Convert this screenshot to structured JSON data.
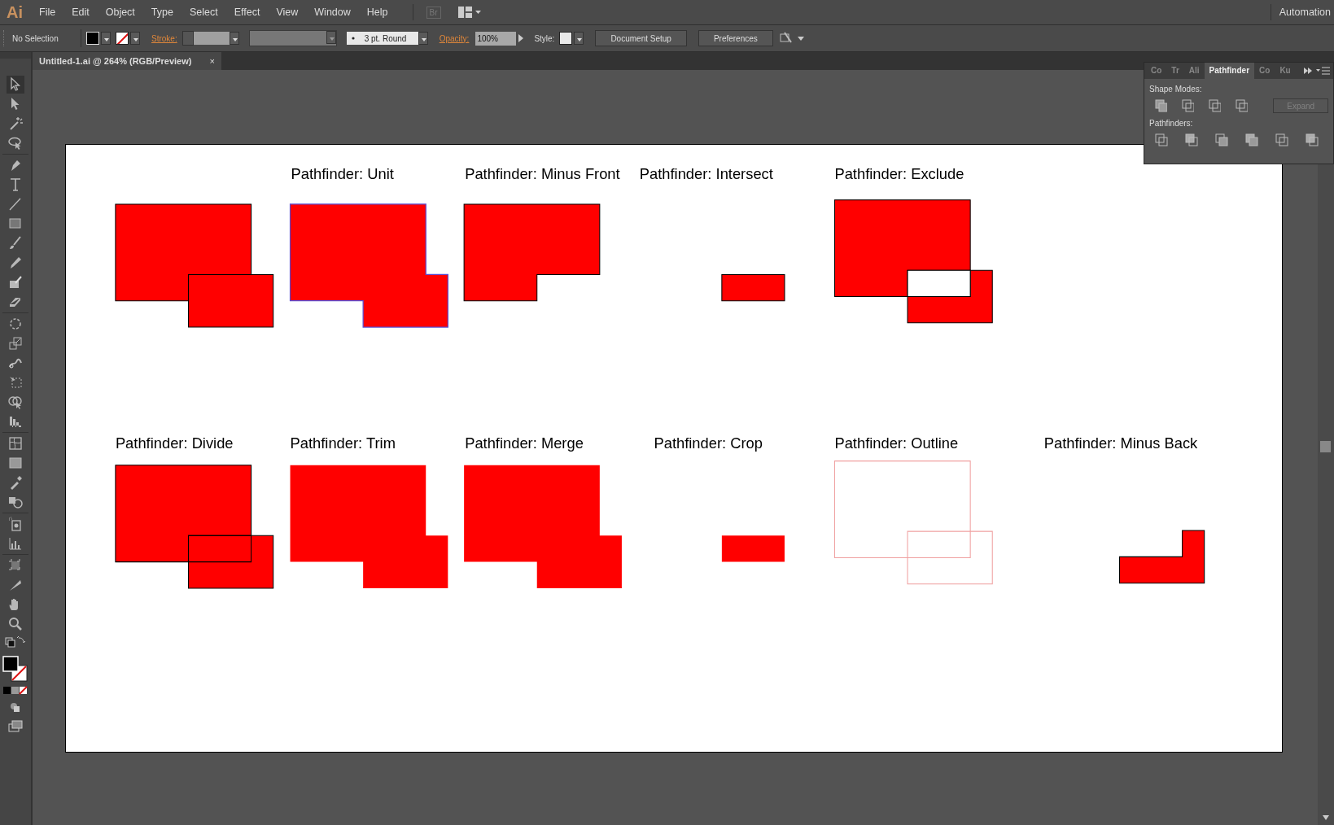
{
  "menu_bar": {
    "logo": "Ai",
    "items": [
      "File",
      "Edit",
      "Object",
      "Type",
      "Select",
      "Effect",
      "View",
      "Window",
      "Help"
    ],
    "bridge": "Br",
    "workspace": "Automation"
  },
  "control_bar": {
    "selection": "No Selection",
    "stroke_label": "Stroke:",
    "brush": "3 pt. Round",
    "opacity_label": "Opacity:",
    "opacity": "100%",
    "style_label": "Style:",
    "buttons": [
      "Document Setup",
      "Preferences"
    ]
  },
  "document_tab": {
    "title": "Untitled-1.ai @ 264% (RGB/Preview)",
    "close": "×"
  },
  "figures": [
    {
      "kind": "original"
    },
    {
      "label": "Pathfinder: Unit",
      "kind": "unite"
    },
    {
      "label": "Pathfinder: Minus Front",
      "kind": "minus_front"
    },
    {
      "label": "Pathfinder: Intersect",
      "kind": "intersect"
    },
    {
      "label": "Pathfinder: Exclude",
      "kind": "exclude"
    },
    {
      "label": "Pathfinder: Divide",
      "kind": "divide"
    },
    {
      "label": "Pathfinder: Trim",
      "kind": "trim"
    },
    {
      "label": "Pathfinder: Merge",
      "kind": "merge"
    },
    {
      "label": "Pathfinder: Crop",
      "kind": "crop"
    },
    {
      "label": "Pathfinder: Outline",
      "kind": "outline"
    },
    {
      "label": "Pathfinder: Minus Back",
      "kind": "minus_back"
    }
  ],
  "panel": {
    "tabs": [
      {
        "label": "Co",
        "selected": false
      },
      {
        "label": "Tr",
        "selected": false
      },
      {
        "label": "Ali",
        "selected": false
      },
      {
        "label": "Pathfinder",
        "selected": true
      },
      {
        "label": "Co",
        "selected": false
      },
      {
        "label": "Ku",
        "selected": false
      }
    ],
    "shape_modes_label": "Shape Modes:",
    "expand": {
      "label": "Expand",
      "disabled": true
    },
    "pathfinders_label": "Pathfinders:"
  }
}
